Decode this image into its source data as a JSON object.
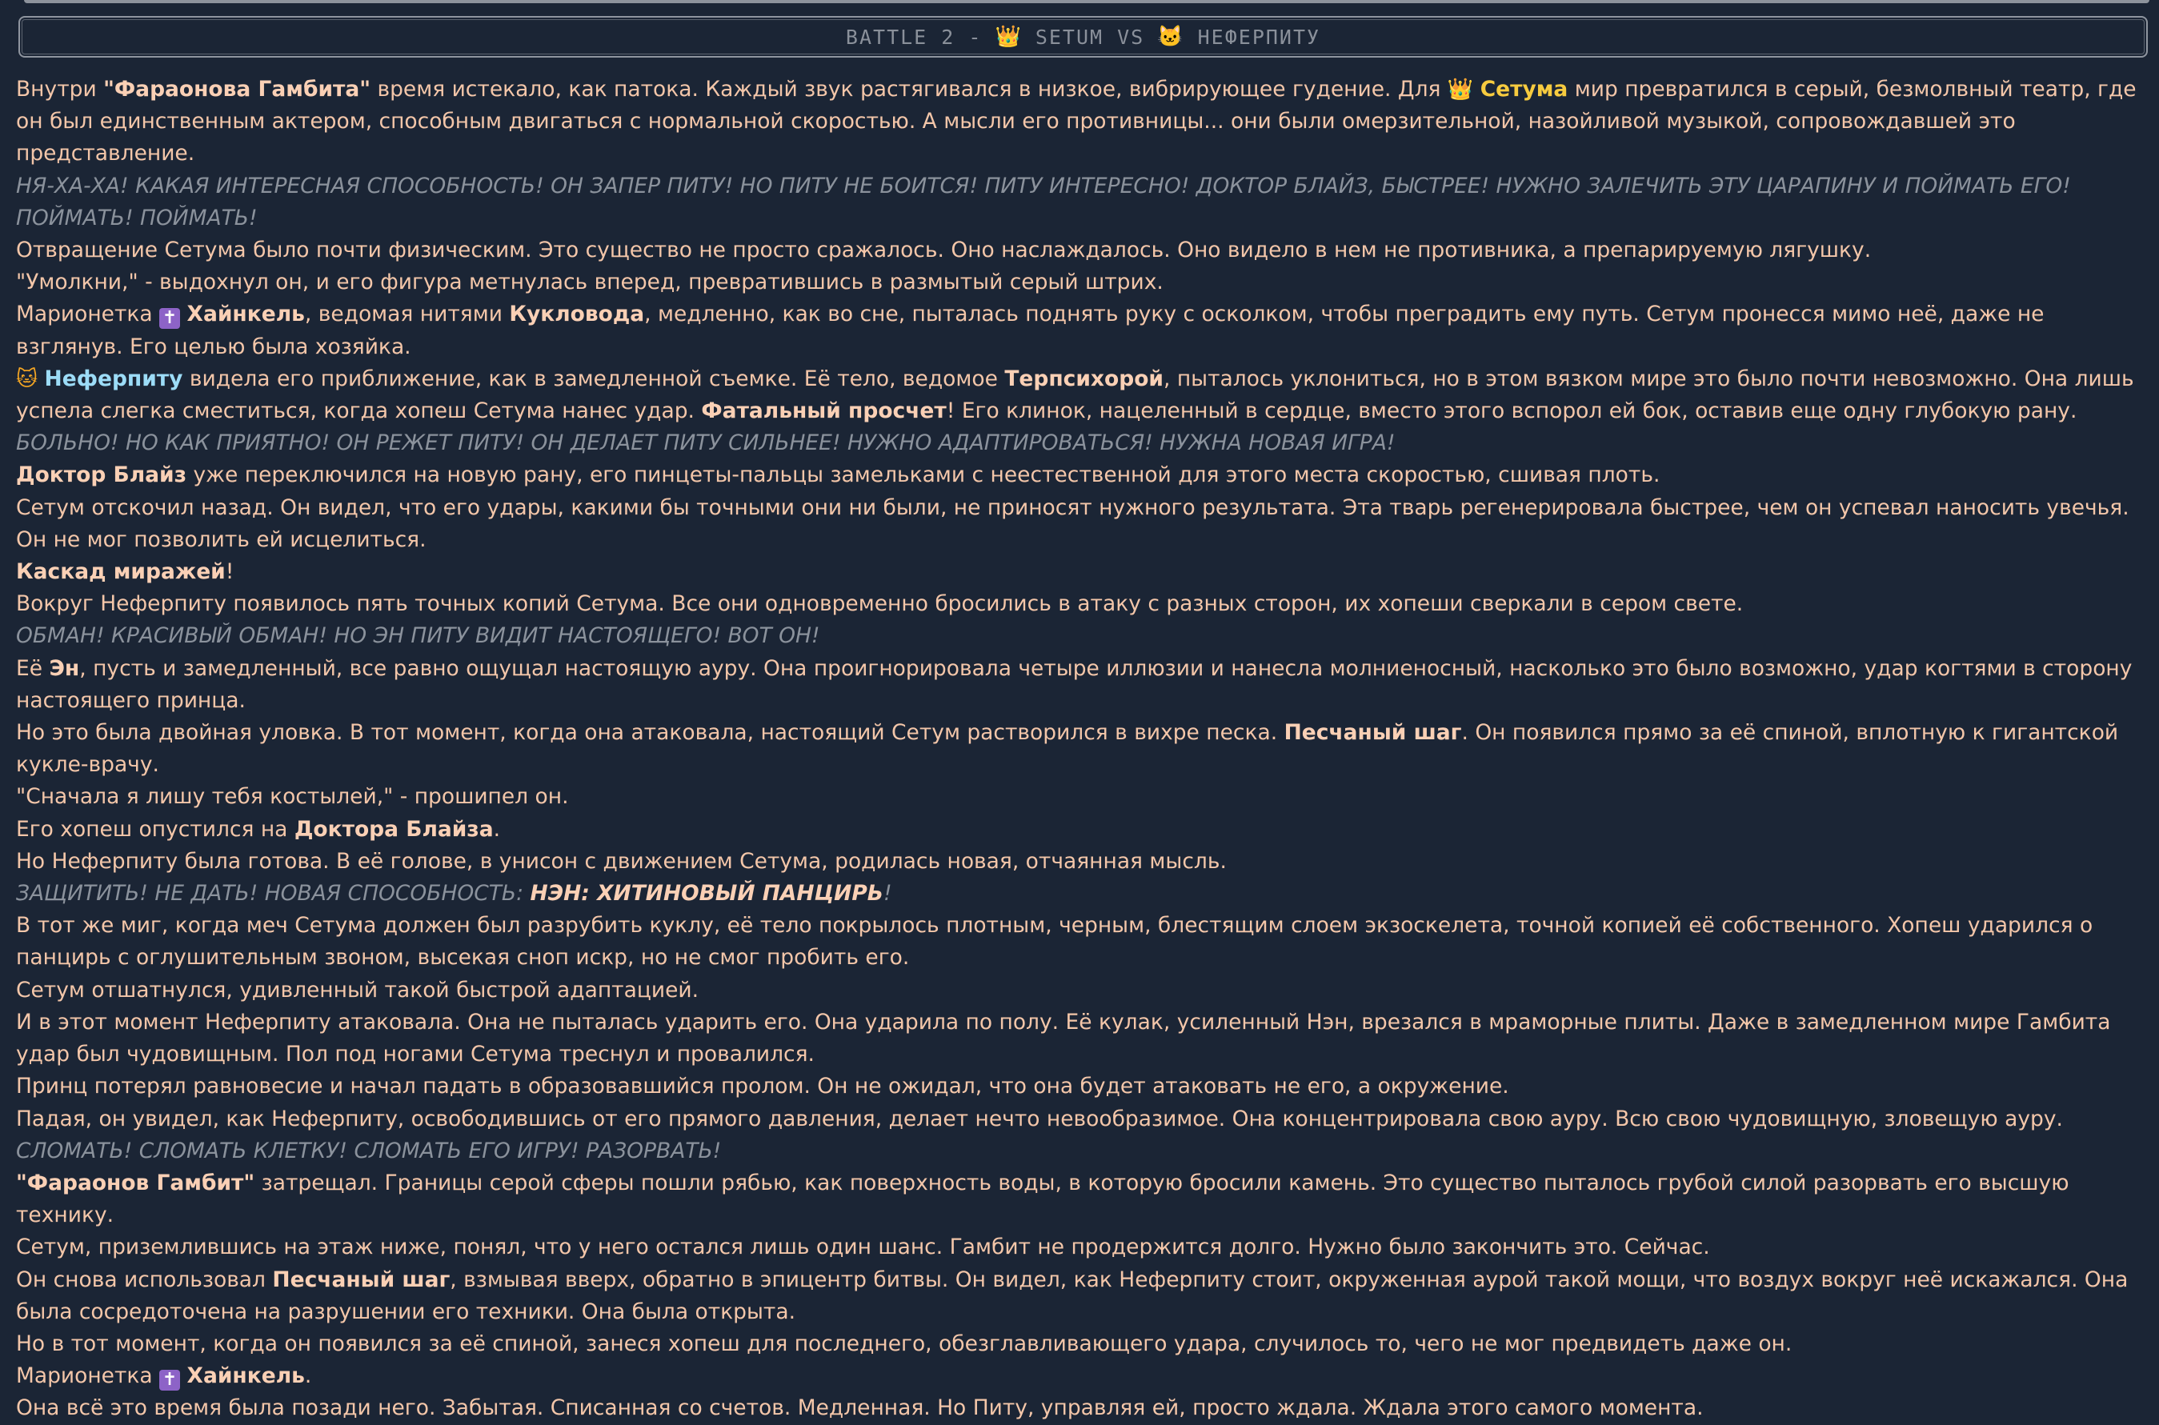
{
  "header": {
    "prefix": "BATTLE 2 -",
    "crown_icon": "👑",
    "left_name": "SETUM VS",
    "cat_icon": "🐱",
    "right_name": "НЕФЕРПИТУ"
  },
  "icons": {
    "crown": "👑",
    "cat": "🐱",
    "cross": "✝"
  },
  "story": {
    "p1_a": "Внутри ",
    "p1_b": "\"Фараонова Гамбита\"",
    "p1_c": " время истекало, как патока. Каждый звук растягивался в низкое, вибрирующее гудение. Для ",
    "p1_d": "Сетума",
    "p1_e": " мир превратился в серый, безмолвный театр, где он был единственным актером, способным двигаться с нормальной скоростью. А мысли его противницы... они были омерзительной, назойливой музыкой, сопровождавшей это представление.",
    "t1": "НЯ-ХА-ХА! КАКАЯ ИНТЕРЕСНАЯ СПОСОБНОСТЬ! ОН ЗАПЕР ПИТУ! НО ПИТУ НЕ БОИТСЯ! ПИТУ ИНТЕРЕСНО! ДОКТОР БЛАЙЗ, БЫСТРЕЕ! НУЖНО ЗАЛЕЧИТЬ ЭТУ ЦАРАПИНУ И ПОЙМАТЬ ЕГО! ПОЙМАТЬ! ПОЙМАТЬ!",
    "p2": "Отвращение Сетума было почти физическим. Это существо не просто сражалось. Оно наслаждалось. Оно видело в нем не противника, а препарируемую лягушку.",
    "p3": "\"Умолкни,\" - выдохнул он, и его фигура метнулась вперед, превратившись в размытый серый штрих.",
    "p4_a": "Марионетка ",
    "p4_b": "Хайнкель",
    "p4_c": ", ведомая нитями ",
    "p4_d": "Кукловода",
    "p4_e": ", медленно, как во сне, пыталась поднять руку с осколком, чтобы преградить ему путь. Сетум пронесся мимо неё, даже не взглянув. Его целью была хозяйка.",
    "p5_b": "Неферпиту",
    "p5_c": " видела его приближение, как в замедленной съемке. Её тело, ведомое ",
    "p5_d": "Терпсихорой",
    "p5_e": ", пыталось уклониться, но в этом вязком мире это было почти невозможно. Она лишь успела слегка сместиться, когда хопеш Сетума нанес удар. ",
    "p5_f": "Фатальный просчет",
    "p5_g": "! Его клинок, нацеленный в сердце, вместо этого вспорол ей бок, оставив еще одну глубокую рану.",
    "t2": "БОЛЬНО! НО КАК ПРИЯТНО! ОН РЕЖЕТ ПИТУ! ОН ДЕЛАЕТ ПИТУ СИЛЬНЕЕ! НУЖНО АДАПТИРОВАТЬСЯ! НУЖНА НОВАЯ ИГРА!",
    "p6_a": "Доктор Блайз",
    "p6_b": " уже переключился на новую рану, его пинцеты-пальцы замельками с неестественной для этого места скоростью, сшивая плоть.",
    "p7": "Сетум отскочил назад. Он видел, что его удары, какими бы точными они ни были, не приносят нужного результата. Эта тварь регенерировала быстрее, чем он успевал наносить увечья. Он не мог позволить ей исцелиться.",
    "p8_a": "Каскад миражей",
    "p8_b": "!",
    "p9": "Вокруг Неферпиту появилось пять точных копий Сетума. Все они одновременно бросились в атаку с разных сторон, их хопеши сверкали в сером свете.",
    "t3": "ОБМАН! КРАСИВЫЙ ОБМАН! НО ЭН ПИТУ ВИДИТ НАСТОЯЩЕГО! ВОТ ОН!",
    "p10_a": "Её ",
    "p10_b": "Эн",
    "p10_c": ", пусть и замедленный, все равно ощущал настоящую ауру. Она проигнорировала четыре иллюзии и нанесла молниеносный, насколько это было возможно, удар когтями в сторону настоящего принца.",
    "p11_a": "Но это была двойная уловка. В тот момент, когда она атаковала, настоящий Сетум растворился в вихре песка. ",
    "p11_b": "Песчаный шаг",
    "p11_c": ". Он появился прямо за её спиной, вплотную к гигантской кукле-врачу.",
    "p12": "\"Сначала я лишу тебя костылей,\" - прошипел он.",
    "p13_a": "Его хопеш опустился на ",
    "p13_b": "Доктора Блайза",
    "p13_c": ".",
    "p14": "Но Неферпиту была готова. В её голове, в унисон с движением Сетума, родилась новая, отчаянная мысль.",
    "t4_a": "ЗАЩИТИТЬ! НЕ ДАТЬ! НОВАЯ СПОСОБНОСТЬ: ",
    "t4_b": "НЭН: ХИТИНОВЫЙ ПАНЦИРЬ",
    "t4_c": "!",
    "p15": "В тот же миг, когда меч Сетума должен был разрубить куклу, её тело покрылось плотным, черным, блестящим слоем экзоскелета, точной копией её собственного. Хопеш ударился о панцирь с оглушительным звоном, высекая сноп искр, но не смог пробить его.",
    "p16": "Сетум отшатнулся, удивленный такой быстрой адаптацией.",
    "p17": "И в этот момент Неферпиту атаковала. Она не пыталась ударить его. Она ударила по полу. Её кулак, усиленный Нэн, врезался в мраморные плиты. Даже в замедленном мире Гамбита удар был чудовищным. Пол под ногами Сетума треснул и провалился.",
    "p18": "Принц потерял равновесие и начал падать в образовавшийся пролом. Он не ожидал, что она будет атаковать не его, а окружение.",
    "p19": "Падая, он увидел, как Неферпиту, освободившись от его прямого давления, делает нечто невообразимое. Она концентрировала свою ауру. Всю свою чудовищную, зловещую ауру.",
    "t5": "СЛОМАТЬ! СЛОМАТЬ КЛЕТКУ! СЛОМАТЬ ЕГО ИГРУ! РАЗОРВАТЬ!",
    "p20_a": "\"Фараонов Гамбит\"",
    "p20_b": " затрещал. Границы серой сферы пошли рябью, как поверхность воды, в которую бросили камень. Это существо пыталось грубой силой разорвать его высшую технику.",
    "p21": "Сетум, приземлившись на этаж ниже, понял, что у него остался лишь один шанс. Гамбит не продержится долго. Нужно было закончить это. Сейчас.",
    "p22_a": "Он снова использовал ",
    "p22_b": "Песчаный шаг",
    "p22_c": ", взмывая вверх, обратно в эпицентр битвы. Он видел, как Неферпиту стоит, окруженная аурой такой мощи, что воздух вокруг неё искажался. Она была сосредоточена на разрушении его техники. Она была открыта.",
    "p23": "Но в тот момент, когда он появился за её спиной, занеся хопеш для последнего, обезглавливающего удара, случилось то, чего не мог предвидеть даже он.",
    "p24_a": "Марионетка ",
    "p24_b": "Хайнкель",
    "p24_c": ".",
    "p25": "Она всё это время была позади него. Забытая. Списанная со счетов. Медленная. Но Питу, управляя ей, просто ждала. Ждала этого самого момента."
  }
}
